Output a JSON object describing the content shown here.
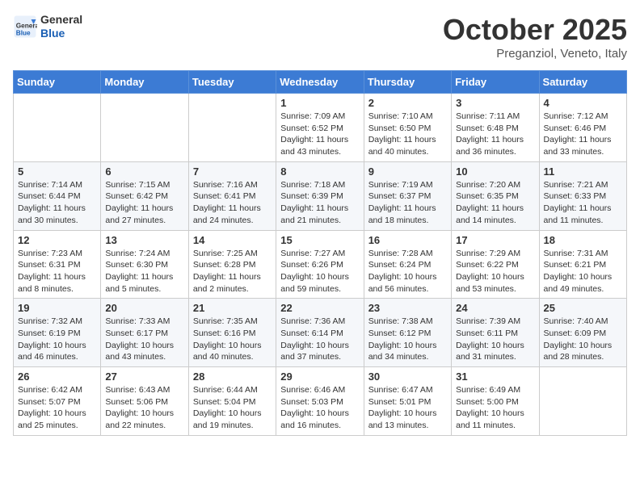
{
  "header": {
    "logo_general": "General",
    "logo_blue": "Blue",
    "month_title": "October 2025",
    "location": "Preganziol, Veneto, Italy"
  },
  "calendar": {
    "days_of_week": [
      "Sunday",
      "Monday",
      "Tuesday",
      "Wednesday",
      "Thursday",
      "Friday",
      "Saturday"
    ],
    "weeks": [
      [
        {
          "day": "",
          "info": ""
        },
        {
          "day": "",
          "info": ""
        },
        {
          "day": "",
          "info": ""
        },
        {
          "day": "1",
          "info": "Sunrise: 7:09 AM\nSunset: 6:52 PM\nDaylight: 11 hours and 43 minutes."
        },
        {
          "day": "2",
          "info": "Sunrise: 7:10 AM\nSunset: 6:50 PM\nDaylight: 11 hours and 40 minutes."
        },
        {
          "day": "3",
          "info": "Sunrise: 7:11 AM\nSunset: 6:48 PM\nDaylight: 11 hours and 36 minutes."
        },
        {
          "day": "4",
          "info": "Sunrise: 7:12 AM\nSunset: 6:46 PM\nDaylight: 11 hours and 33 minutes."
        }
      ],
      [
        {
          "day": "5",
          "info": "Sunrise: 7:14 AM\nSunset: 6:44 PM\nDaylight: 11 hours and 30 minutes."
        },
        {
          "day": "6",
          "info": "Sunrise: 7:15 AM\nSunset: 6:42 PM\nDaylight: 11 hours and 27 minutes."
        },
        {
          "day": "7",
          "info": "Sunrise: 7:16 AM\nSunset: 6:41 PM\nDaylight: 11 hours and 24 minutes."
        },
        {
          "day": "8",
          "info": "Sunrise: 7:18 AM\nSunset: 6:39 PM\nDaylight: 11 hours and 21 minutes."
        },
        {
          "day": "9",
          "info": "Sunrise: 7:19 AM\nSunset: 6:37 PM\nDaylight: 11 hours and 18 minutes."
        },
        {
          "day": "10",
          "info": "Sunrise: 7:20 AM\nSunset: 6:35 PM\nDaylight: 11 hours and 14 minutes."
        },
        {
          "day": "11",
          "info": "Sunrise: 7:21 AM\nSunset: 6:33 PM\nDaylight: 11 hours and 11 minutes."
        }
      ],
      [
        {
          "day": "12",
          "info": "Sunrise: 7:23 AM\nSunset: 6:31 PM\nDaylight: 11 hours and 8 minutes."
        },
        {
          "day": "13",
          "info": "Sunrise: 7:24 AM\nSunset: 6:30 PM\nDaylight: 11 hours and 5 minutes."
        },
        {
          "day": "14",
          "info": "Sunrise: 7:25 AM\nSunset: 6:28 PM\nDaylight: 11 hours and 2 minutes."
        },
        {
          "day": "15",
          "info": "Sunrise: 7:27 AM\nSunset: 6:26 PM\nDaylight: 10 hours and 59 minutes."
        },
        {
          "day": "16",
          "info": "Sunrise: 7:28 AM\nSunset: 6:24 PM\nDaylight: 10 hours and 56 minutes."
        },
        {
          "day": "17",
          "info": "Sunrise: 7:29 AM\nSunset: 6:22 PM\nDaylight: 10 hours and 53 minutes."
        },
        {
          "day": "18",
          "info": "Sunrise: 7:31 AM\nSunset: 6:21 PM\nDaylight: 10 hours and 49 minutes."
        }
      ],
      [
        {
          "day": "19",
          "info": "Sunrise: 7:32 AM\nSunset: 6:19 PM\nDaylight: 10 hours and 46 minutes."
        },
        {
          "day": "20",
          "info": "Sunrise: 7:33 AM\nSunset: 6:17 PM\nDaylight: 10 hours and 43 minutes."
        },
        {
          "day": "21",
          "info": "Sunrise: 7:35 AM\nSunset: 6:16 PM\nDaylight: 10 hours and 40 minutes."
        },
        {
          "day": "22",
          "info": "Sunrise: 7:36 AM\nSunset: 6:14 PM\nDaylight: 10 hours and 37 minutes."
        },
        {
          "day": "23",
          "info": "Sunrise: 7:38 AM\nSunset: 6:12 PM\nDaylight: 10 hours and 34 minutes."
        },
        {
          "day": "24",
          "info": "Sunrise: 7:39 AM\nSunset: 6:11 PM\nDaylight: 10 hours and 31 minutes."
        },
        {
          "day": "25",
          "info": "Sunrise: 7:40 AM\nSunset: 6:09 PM\nDaylight: 10 hours and 28 minutes."
        }
      ],
      [
        {
          "day": "26",
          "info": "Sunrise: 6:42 AM\nSunset: 5:07 PM\nDaylight: 10 hours and 25 minutes."
        },
        {
          "day": "27",
          "info": "Sunrise: 6:43 AM\nSunset: 5:06 PM\nDaylight: 10 hours and 22 minutes."
        },
        {
          "day": "28",
          "info": "Sunrise: 6:44 AM\nSunset: 5:04 PM\nDaylight: 10 hours and 19 minutes."
        },
        {
          "day": "29",
          "info": "Sunrise: 6:46 AM\nSunset: 5:03 PM\nDaylight: 10 hours and 16 minutes."
        },
        {
          "day": "30",
          "info": "Sunrise: 6:47 AM\nSunset: 5:01 PM\nDaylight: 10 hours and 13 minutes."
        },
        {
          "day": "31",
          "info": "Sunrise: 6:49 AM\nSunset: 5:00 PM\nDaylight: 10 hours and 11 minutes."
        },
        {
          "day": "",
          "info": ""
        }
      ]
    ]
  }
}
